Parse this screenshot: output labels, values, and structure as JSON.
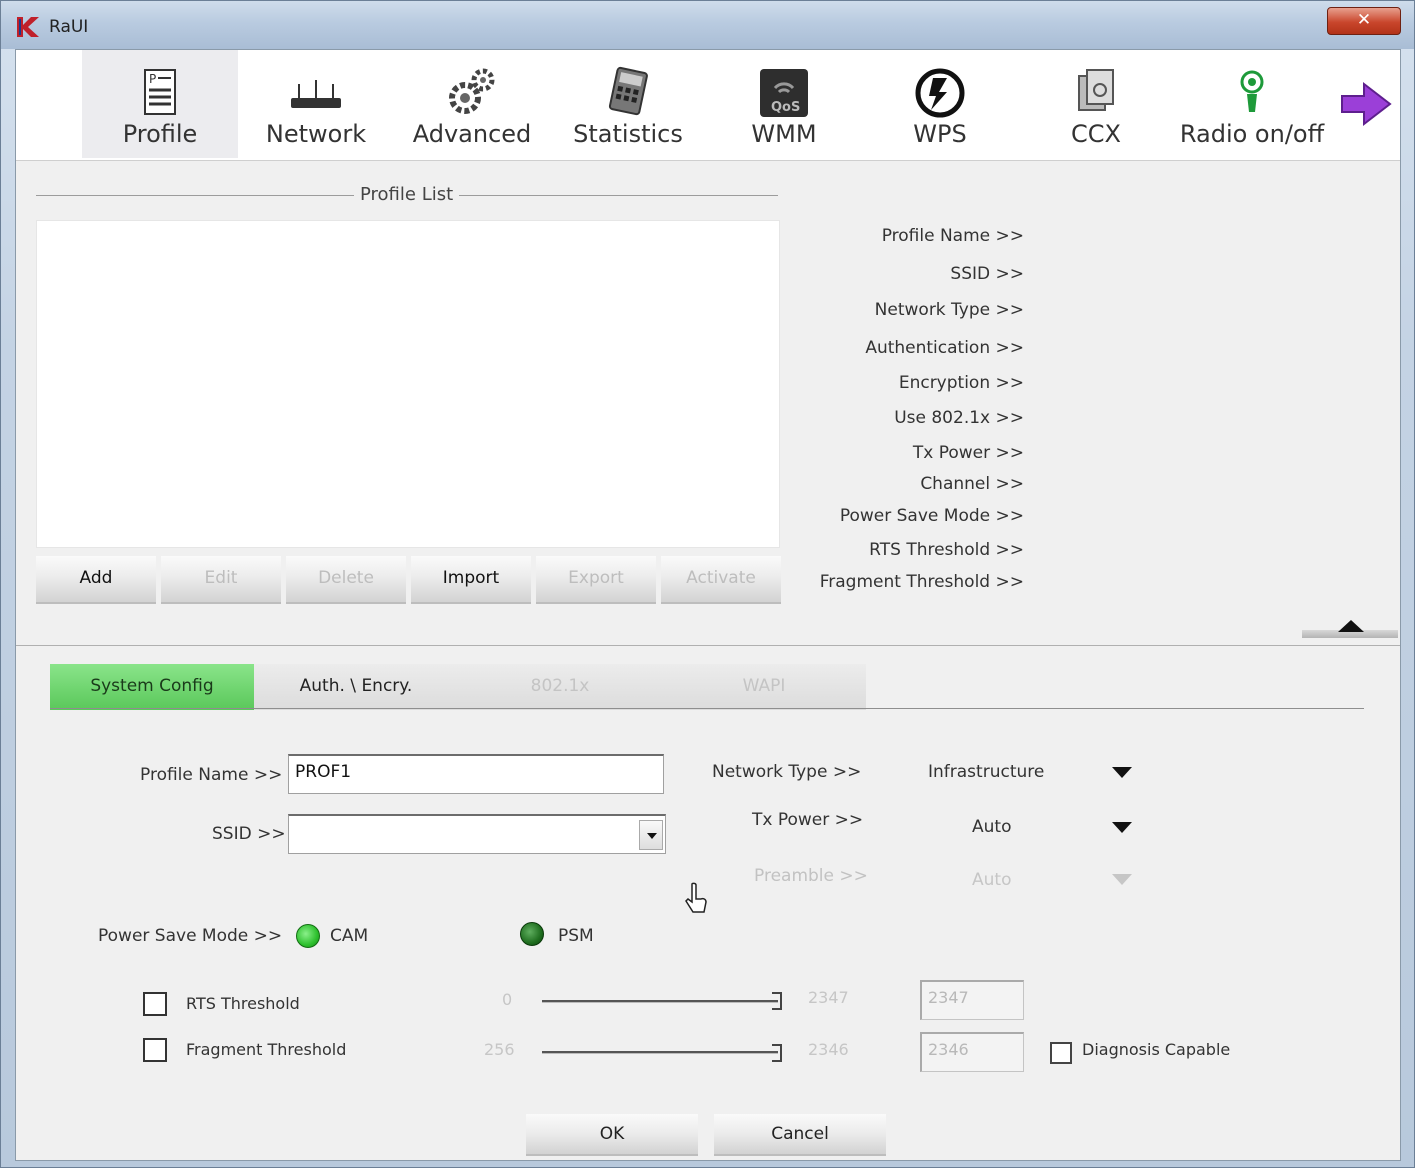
{
  "window": {
    "title": "RaUI",
    "close_glyph": "✕"
  },
  "toolbar": {
    "items": [
      {
        "label": "Profile",
        "icon": "profile-icon"
      },
      {
        "label": "Network",
        "icon": "network-icon"
      },
      {
        "label": "Advanced",
        "icon": "advanced-icon"
      },
      {
        "label": "Statistics",
        "icon": "statistics-icon"
      },
      {
        "label": "WMM",
        "icon": "wmm-icon"
      },
      {
        "label": "WPS",
        "icon": "wps-icon"
      },
      {
        "label": "CCX",
        "icon": "ccx-icon"
      },
      {
        "label": "Radio on/off",
        "icon": "radio-icon"
      }
    ],
    "next_icon": "next-arrow-icon"
  },
  "profile_list": {
    "title": "Profile List",
    "buttons": {
      "add": "Add",
      "edit": "Edit",
      "delete": "Delete",
      "import": "Import",
      "export": "Export",
      "activate": "Activate"
    }
  },
  "info_labels": [
    "Profile Name >>",
    "SSID >>",
    "Network Type >>",
    "Authentication >>",
    "Encryption >>",
    "Use 802.1x >>",
    "Tx Power >>",
    "Channel >>",
    "Power Save Mode >>",
    "RTS Threshold >>",
    "Fragment Threshold >>"
  ],
  "tabs": {
    "system_config": "System Config",
    "auth_encry": "Auth. \\ Encry.",
    "dot1x": "802.1x",
    "wapi": "WAPI"
  },
  "form": {
    "profile_name_label": "Profile Name >>",
    "profile_name_value": "PROF1",
    "ssid_label": "SSID >>",
    "ssid_value": "",
    "network_type_label": "Network Type >>",
    "network_type_value": "Infrastructure",
    "tx_power_label": "Tx Power >>",
    "tx_power_value": "Auto",
    "preamble_label": "Preamble >>",
    "preamble_value": "Auto",
    "power_save_label": "Power Save Mode >>",
    "power_save_options": [
      "CAM",
      "PSM"
    ],
    "power_save_selected": "PSM",
    "rts_label": "RTS Threshold",
    "rts_min": "0",
    "rts_max": "2347",
    "rts_value": "2347",
    "frag_label": "Fragment Threshold",
    "frag_min": "256",
    "frag_max": "2346",
    "frag_value": "2346",
    "diagnosis_label": "Diagnosis Capable"
  },
  "dialog_buttons": {
    "ok": "OK",
    "cancel": "Cancel"
  },
  "colors": {
    "active_tab": "#5ac85a",
    "close_button": "#c9462c",
    "next_arrow": "#9b3fd8"
  }
}
